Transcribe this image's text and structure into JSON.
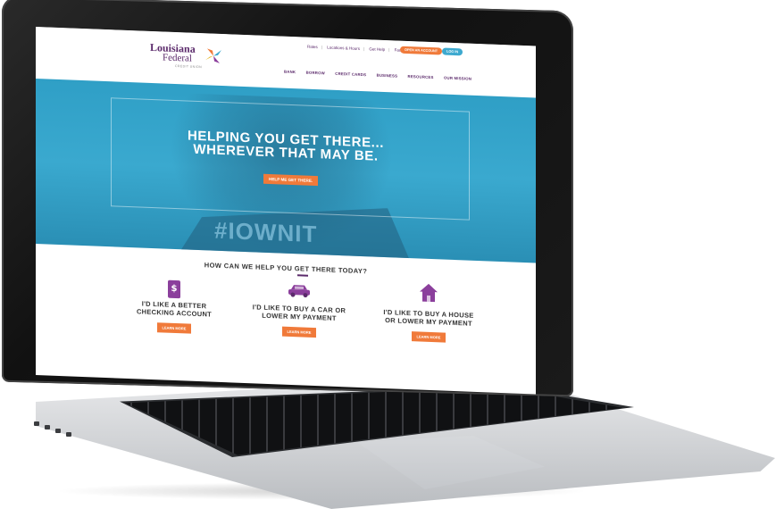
{
  "brand": {
    "name_line1": "Louisiana",
    "name_line2": "Federal",
    "tagline": "CREDIT UNION"
  },
  "utility_nav": {
    "links": [
      "Rates",
      "Locations & Hours",
      "Get Help",
      "Facebook"
    ],
    "open_account": "OPEN AN ACCOUNT",
    "login": "LOG IN"
  },
  "main_nav": {
    "items": [
      "BANK",
      "BORROW",
      "CREDIT CARDS",
      "BUSINESS",
      "RESOURCES",
      "OUR MISSION"
    ]
  },
  "hero": {
    "title_line1": "HELPING YOU GET THERE...",
    "title_line2": "WHEREVER THAT MAY BE.",
    "cta": "HELP ME GET THERE.",
    "shirt_text": "#IOWNIT"
  },
  "help": {
    "title": "HOW CAN WE HELP YOU GET THERE TODAY?",
    "cards": [
      {
        "icon": "phone-dollar-icon",
        "line1": "I'D LIKE A BETTER",
        "line2": "CHECKING ACCOUNT",
        "cta": "LEARN MORE"
      },
      {
        "icon": "car-icon",
        "line1": "I'D LIKE TO BUY A CAR OR",
        "line2": "LOWER MY PAYMENT",
        "cta": "LEARN MORE"
      },
      {
        "icon": "house-icon",
        "line1": "I'D LIKE TO BUY A HOUSE",
        "line2": "OR LOWER MY PAYMENT",
        "cta": "LEARN MORE"
      }
    ]
  },
  "colors": {
    "brand_purple": "#5b2a6b",
    "accent_orange": "#f07a3a",
    "accent_blue": "#3da9cf",
    "hero_blue": "#3aa9cf",
    "icon_purple": "#8b3f9c"
  }
}
